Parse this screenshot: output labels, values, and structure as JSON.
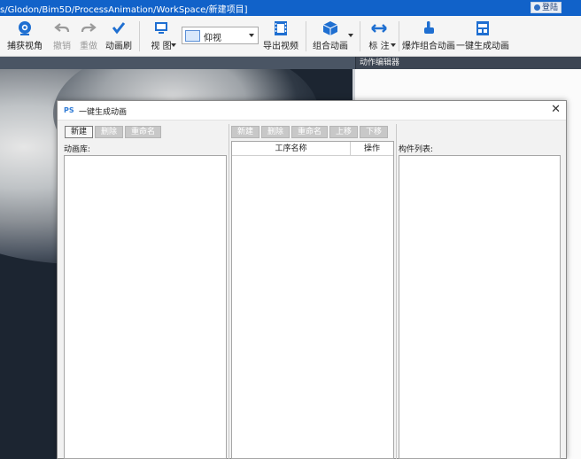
{
  "titlebar": {
    "path": "s/Glodon/Bim5D/ProcessAnimation/WorkSpace/新建项目]",
    "login": "登陆"
  },
  "toolbar": {
    "capture_view": "捕获视角",
    "undo": "撤销",
    "redo": "重做",
    "animation_brush": "动画刷",
    "view": "视 图",
    "view_mode": "仰视",
    "export_video": "导出视频",
    "combo_animation": "组合动画",
    "annotate": "标 注",
    "explode_combo": "爆炸组合动画",
    "one_click_generate": "一键生成动画"
  },
  "panel": {
    "action_editor": "动作编辑器"
  },
  "dialog": {
    "title": "一键生成动画",
    "left": {
      "buttons": [
        "新建",
        "删除",
        "重命名"
      ],
      "label": "动画库:"
    },
    "middle": {
      "buttons": [
        "新建",
        "删除",
        "重命名",
        "上移",
        "下移"
      ],
      "columns": [
        "工序名称",
        "操作"
      ]
    },
    "right": {
      "label": "构件列表:"
    }
  },
  "colors": {
    "titlebar": "#1162c9",
    "toolbar_icon": "#1f6fd1",
    "viewport": "#1c2531"
  }
}
